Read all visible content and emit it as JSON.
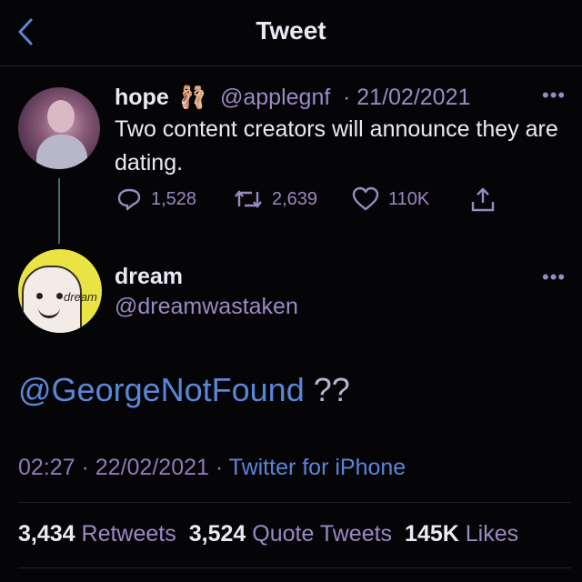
{
  "header": {
    "title": "Tweet",
    "back_icon": "chevron-left-icon"
  },
  "reply_to": {
    "name": "hope",
    "emoji": "🩰",
    "handle": "@applegnf",
    "date": "· 21/02/2021",
    "text": "Two content creators will announce they are dating.",
    "actions": {
      "replies": "1,528",
      "retweets": "2,639",
      "likes": "110K"
    }
  },
  "tweet": {
    "name": "dream",
    "handle": "@dreamwastaken",
    "avatar_text": "dream",
    "mention": "@GeorgeNotFound",
    "rest": " ??",
    "time": "02:27 · 22/02/2021 ·",
    "source": "Twitter for iPhone"
  },
  "stats": {
    "retweets_count": "3,434",
    "retweets_label": "Retweets",
    "quotes_count": "3,524",
    "quotes_label": "Quote Tweets",
    "likes_count": "145K",
    "likes_label": "Likes"
  },
  "colors": {
    "accent": "#5a86d6",
    "muted": "#9a89c2",
    "background": "#050508"
  }
}
